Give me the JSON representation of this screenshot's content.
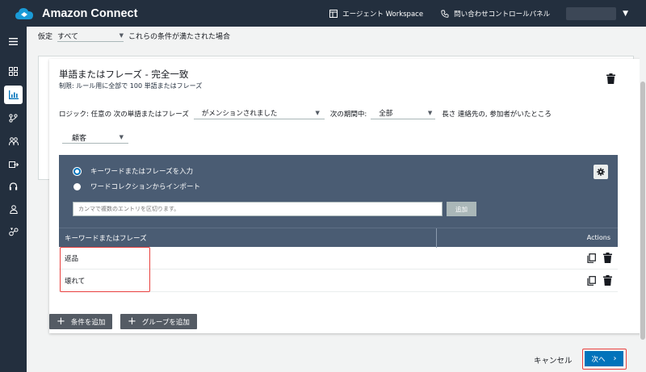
{
  "header": {
    "brand": "Amazon Connect",
    "workspace_link": "エージェント Workspace",
    "ccp_link": "問い合わせコントロールパネル"
  },
  "filter": {
    "label": "仮定",
    "selected": "すべて",
    "condition_text": "これらの条件が満たされた場合"
  },
  "rule": {
    "title": "単語またはフレーズ - 完全一致",
    "subtitle": "制限: ルール用に全部で 100 単語またはフレーズ",
    "logic_label": "ロジック: 任意の 次の単語またはフレーズ",
    "mention_selected": "がメンションされました",
    "period_label": "次の期間中:",
    "period_selected": "全部",
    "length_text": "長さ 連絡先の, 参加者がいたところ",
    "participant_selected": "顧客"
  },
  "keywords": {
    "radio_enter": "キーワードまたはフレーズを入力",
    "radio_import": "ワードコレクションからインポート",
    "input_placeholder": "カンマで複数のエントリを区切ります。",
    "add_label": "追加",
    "col_keyword": "キーワードまたはフレーズ",
    "col_actions": "Actions",
    "rows": [
      "返品",
      "壊れて"
    ]
  },
  "actions": {
    "add_condition": "条件を追加",
    "add_group": "グループを追加",
    "cancel": "キャンセル",
    "next": "次へ"
  },
  "colors": {
    "topbar": "#232f3e",
    "panel": "#4a5c73",
    "primary": "#0073bb",
    "highlight": "#e8403e"
  }
}
